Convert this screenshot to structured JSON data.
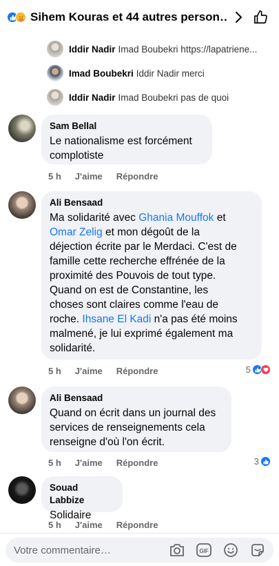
{
  "header": {
    "title": "Sihem Kouras et 44 autres person…",
    "reactions": [
      "like-icon",
      "care-icon"
    ],
    "next_icon": "chevron-right-icon",
    "like_icon": "thumbs-up-outline-icon"
  },
  "replies": [
    {
      "name": "Iddir Nadir",
      "text": "Imad Boubekri https://lapatriene..."
    },
    {
      "name": "Imad Boubekri",
      "text": "Iddir Nadir merci"
    },
    {
      "name": "Iddir Nadir",
      "text": "Imad Boubekri pas de quoi"
    }
  ],
  "comments": [
    {
      "name": "Sam Bellal",
      "lines": [
        "Le nationalisme est forcément",
        "complotiste"
      ],
      "time": "5 h",
      "like": "J'aime",
      "reply": "Répondre"
    },
    {
      "name": "Ali Bensaad",
      "lines": [
        [
          "Ma solidarité avec ",
          {
            "m": "Ghania Mouffok"
          },
          " et"
        ],
        [
          {
            "m": "Omar Zelig"
          },
          " et mon dégoût de la"
        ],
        [
          "déjection écrite par le Merdaci. C'est de"
        ],
        [
          "famille  cette recherche effrénée de la"
        ],
        [
          "proximité des Pouvois de tout type."
        ],
        [
          "Quand on est de Constantine,  les"
        ],
        [
          "choses sont claires comme l'eau de"
        ],
        [
          "roche. ",
          {
            "m": "Ihsane El Kadi"
          },
          " n'a pas été moins"
        ],
        [
          "malmené, je lui exprimé également ma"
        ],
        [
          "solidarité."
        ]
      ],
      "time": "5 h",
      "like": "J'aime",
      "reply": "Répondre",
      "reaction_count": "5"
    },
    {
      "name": "Ali Bensaad",
      "lines": [
        "Quand on écrit dans un journal des",
        "services de renseignements   cela",
        "renseigne d'où l'on écrit."
      ],
      "time": "5 h",
      "like": "J'aime",
      "reply": "Répondre",
      "reaction_count": "3"
    },
    {
      "name": "Souad Labbize",
      "lines": [
        "Solidaire"
      ],
      "time": "5 h",
      "like": "J'aime",
      "reply": "Répondre"
    }
  ],
  "composer": {
    "placeholder": "Votre commentaire…",
    "icons": [
      "camera-icon",
      "gif-icon",
      "emoji-icon",
      "sticker-icon"
    ],
    "gif_label": "GIF"
  },
  "colors": {
    "accent": "#1877f2",
    "bubble": "#f0f2f5",
    "secondary_text": "#65676b",
    "love": "#f33e58",
    "care": "#f7b928"
  }
}
